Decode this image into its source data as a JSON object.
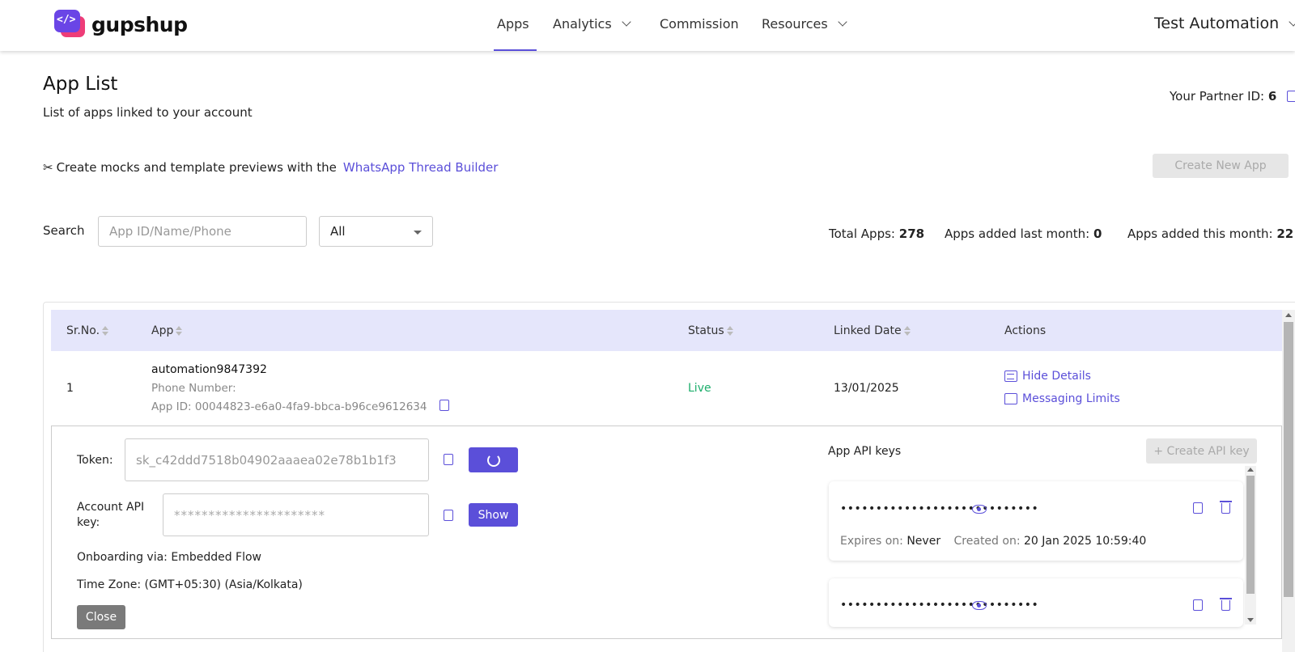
{
  "brand": {
    "name": "gupshup",
    "logo_icon": "code-chat-logo-icon",
    "accent": "#5b4fd9",
    "logo_colors": [
      "#6a45e6",
      "#ee3d78"
    ]
  },
  "nav": {
    "items": [
      {
        "label": "Apps",
        "active": true
      },
      {
        "label": "Analytics",
        "dropdown": true
      },
      {
        "label": "Commission"
      },
      {
        "label": "Resources",
        "dropdown": true
      }
    ],
    "account": "Test Automation"
  },
  "page": {
    "title": "App List",
    "subtitle": "List of apps linked to your account",
    "partner_label": "Your Partner ID:",
    "partner_id": "6"
  },
  "builder": {
    "text": "Create mocks and template previews with the",
    "link": "WhatsApp Thread Builder"
  },
  "create_app_label": "Create New App",
  "search": {
    "label": "Search",
    "placeholder": "App ID/Name/Phone",
    "filter_value": "All"
  },
  "stats": {
    "total_label": "Total Apps:",
    "total": "278",
    "last_month_label": "Apps added last month:",
    "last_month": "0",
    "this_month_label": "Apps added this month:",
    "this_month": "22"
  },
  "table": {
    "headers": [
      "Sr.No.",
      "App",
      "Status",
      "Linked Date",
      "Actions"
    ],
    "rows": [
      {
        "srno": "1",
        "name": "automation9847392",
        "phone": "Phone Number:",
        "app_id": "App ID: 00044823-e6a0-4fa9-bbca-b96ce9612634",
        "status": "Live",
        "linked": "13/01/2025",
        "actions": [
          "Hide Details",
          "Messaging Limits"
        ]
      }
    ]
  },
  "details": {
    "token_label": "Token:",
    "token_value": "sk_c42ddd7518b04902aaaea02e78b1b1f3",
    "apikey_label": "Account API key:",
    "apikey_value": "**********************",
    "show_label": "Show",
    "onboarding_label": "Onboarding via:",
    "onboarding_value": "Embedded Flow",
    "timezone_label": "Time Zone:",
    "timezone_value": "(GMT+05:30) (Asia/Kolkata)",
    "close_label": "Close",
    "keys_title": "App API keys",
    "create_key_label": "+ Create API key",
    "keys": [
      {
        "masked": "••••••••••••••••••••••••••••",
        "expires_label": "Expires on:",
        "expires": "Never",
        "created_label": "Created on:",
        "created": "20 Jan 2025 10:59:40"
      },
      {
        "masked": "••••••••••••••••••••••••••••"
      }
    ]
  },
  "colors": {
    "status_live": "#1cae6b",
    "table_header_bg": "#e5e6fb",
    "disabled_button_bg": "#e6e6e6"
  }
}
